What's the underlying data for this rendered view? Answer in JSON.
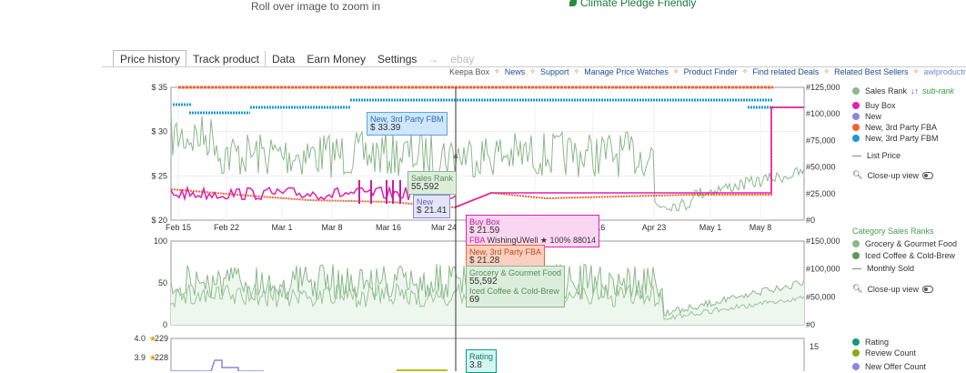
{
  "header": {
    "zoom_note": "Roll over image to zoom in",
    "climate": "Climate Pledge Friendly"
  },
  "tabs": [
    {
      "label": "Price history",
      "active": true
    },
    {
      "label": "Track product"
    },
    {
      "label": "Data"
    },
    {
      "label": "Earn Money"
    },
    {
      "label": "Settings"
    },
    {
      "label": "ebay"
    }
  ],
  "links": [
    "Keepa Box",
    "News",
    "Support",
    "Manage Price Watches",
    "Product Finder",
    "Find related Deals",
    "Related Best Sellers",
    "awlproductresearch"
  ],
  "price_chart": {
    "y_left": [
      "$ 35",
      "$ 30",
      "$ 25",
      "$ 20"
    ],
    "y_right": [
      "#125,000",
      "#100,000",
      "#75,000",
      "#50,000",
      "#25,000",
      "#0"
    ],
    "x_labels": [
      "Feb 15",
      "Feb 22",
      "Mar 1",
      "Mar 8",
      "Mar 16",
      "Mar 24",
      "Apr 8",
      "Apr 16",
      "Apr 23",
      "May 1",
      "May 8"
    ]
  },
  "rank_chart": {
    "y_left": [
      "100",
      "50",
      "0"
    ],
    "y_right": [
      "#150,000",
      "#100,000",
      "#50,000",
      "#0"
    ]
  },
  "rating_chart": {
    "y_left_rating": [
      "4.0",
      "3.9"
    ],
    "y_left_count": [
      "229",
      "228"
    ],
    "y_right": [
      "15"
    ]
  },
  "legend": {
    "main": [
      {
        "label": "Sales Rank",
        "color": "#8cb88c",
        "extra": "sub-rank"
      },
      {
        "label": "Buy Box",
        "color": "#e020b0"
      },
      {
        "label": "New",
        "color": "#8888dd"
      },
      {
        "label": "New, 3rd Party FBA",
        "color": "#f0642c"
      },
      {
        "label": "New, 3rd Party FBM",
        "color": "#1e9ad6"
      }
    ],
    "list_price": "List Price",
    "closeup": "Close-up view",
    "category_head": "Category Sales Ranks",
    "categories": [
      {
        "label": "Grocery & Gourmet Food",
        "color": "#8cb88c"
      },
      {
        "label": "Iced Coffee & Cold-Brew",
        "color": "#5a9a5a"
      }
    ],
    "monthly_sold": "Monthly Sold",
    "closeup2": "Close-up view",
    "rating_items": [
      {
        "label": "Rating",
        "color": "#0f9a80"
      },
      {
        "label": "Review Count",
        "color": "#8aaa10"
      },
      {
        "label": "New Offer Count",
        "color": "#8888dd"
      }
    ]
  },
  "tooltips": {
    "fbm": {
      "title": "New, 3rd Party FBM",
      "value": "$ 33.39"
    },
    "sales_rank": {
      "title": "Sales Rank",
      "value": "55,592"
    },
    "new": {
      "title": "New",
      "value": "$ 21.41"
    },
    "buybox": {
      "title": "Buy Box",
      "value": "$ 21.59",
      "seller_prefix": "FBA",
      "seller": "WishingUWell",
      "rating": "★ 100%",
      "count": "88014"
    },
    "fba": {
      "title": "New, 3rd Party FBA",
      "value": "$ 21.28"
    },
    "category": {
      "title": "Grocery & Gourmet Food",
      "value": "55,592",
      "sub": "Iced Coffee & Cold-Brew",
      "sub_value": "69"
    },
    "rating": {
      "title": "Rating",
      "value": "3.8"
    }
  }
}
